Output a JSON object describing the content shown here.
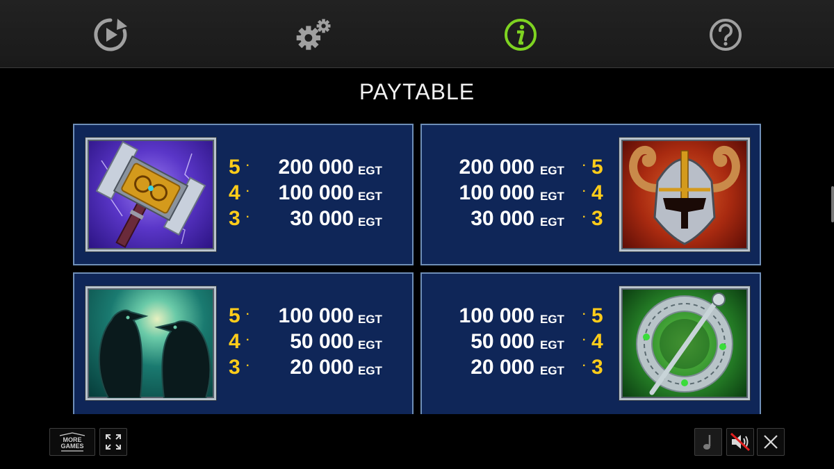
{
  "top_bar": {
    "buttons": [
      {
        "name": "replay",
        "icon": "replay-icon",
        "color": "#a0a0a0"
      },
      {
        "name": "settings",
        "icon": "gears-icon",
        "color": "#a0a0a0"
      },
      {
        "name": "info",
        "icon": "info-icon",
        "color": "#7ed321",
        "active": true
      },
      {
        "name": "help",
        "icon": "question-icon",
        "color": "#a0a0a0"
      }
    ]
  },
  "title": "PAYTABLE",
  "panels": [
    {
      "symbol": "hammer",
      "pays": [
        {
          "count": "5",
          "amount": "200 000",
          "unit": "EGT"
        },
        {
          "count": "4",
          "amount": "100 000",
          "unit": "EGT"
        },
        {
          "count": "3",
          "amount": "30 000",
          "unit": "EGT"
        }
      ]
    },
    {
      "symbol": "horned-helmet",
      "pays": [
        {
          "count": "5",
          "amount": "200 000",
          "unit": "EGT"
        },
        {
          "count": "4",
          "amount": "100 000",
          "unit": "EGT"
        },
        {
          "count": "3",
          "amount": "30 000",
          "unit": "EGT"
        }
      ]
    },
    {
      "symbol": "ravens",
      "pays": [
        {
          "count": "5",
          "amount": "100 000",
          "unit": "EGT"
        },
        {
          "count": "4",
          "amount": "50 000",
          "unit": "EGT"
        },
        {
          "count": "3",
          "amount": "20 000",
          "unit": "EGT"
        }
      ]
    },
    {
      "symbol": "celtic-brooch",
      "pays": [
        {
          "count": "5",
          "amount": "100 000",
          "unit": "EGT"
        },
        {
          "count": "4",
          "amount": "50 000",
          "unit": "EGT"
        },
        {
          "count": "3",
          "amount": "20 000",
          "unit": "EGT"
        }
      ]
    }
  ],
  "bottom_bar": {
    "more_games": {
      "line1": "MORE",
      "line2": "GAMES"
    },
    "buttons": [
      "fullscreen-icon",
      "music-note-icon",
      "sound-muted-icon",
      "close-icon"
    ]
  },
  "colors": {
    "panel_bg": "#0f2658",
    "panel_border": "#6f8fb8",
    "pay_count": "#ffcc1a",
    "active_icon": "#7ed321"
  }
}
